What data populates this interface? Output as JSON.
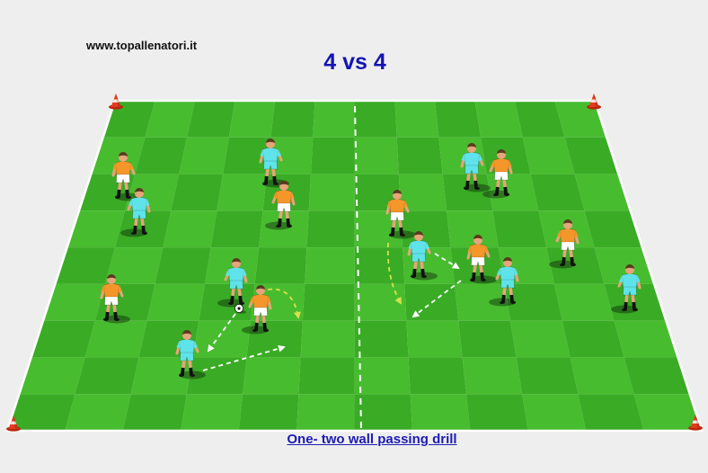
{
  "site": {
    "url": "www.topallenatori.it"
  },
  "diagram": {
    "title": "4 vs 4",
    "caption": "One- two wall passing drill"
  },
  "colors": {
    "background": "#eeeeee",
    "pitch_light": "#47bc2f",
    "pitch_dark": "#3aab25",
    "pitch_line": "#ffffff",
    "title_text": "#1414b4",
    "caption_link": "#1c1cb4",
    "orange_team_shirt": "#f5962a",
    "orange_team_shorts": "#ffffff",
    "cyan_team_shirt": "#5fe3ea",
    "cyan_team_shorts": "#5fe3ea",
    "pass_arrow": "#ffffff",
    "run_arrow": "#d8e04a",
    "cone": "#e63a1e"
  },
  "icons": {
    "ball": "soccer-ball-icon",
    "cone": "cone-icon",
    "player": "player-icon"
  }
}
